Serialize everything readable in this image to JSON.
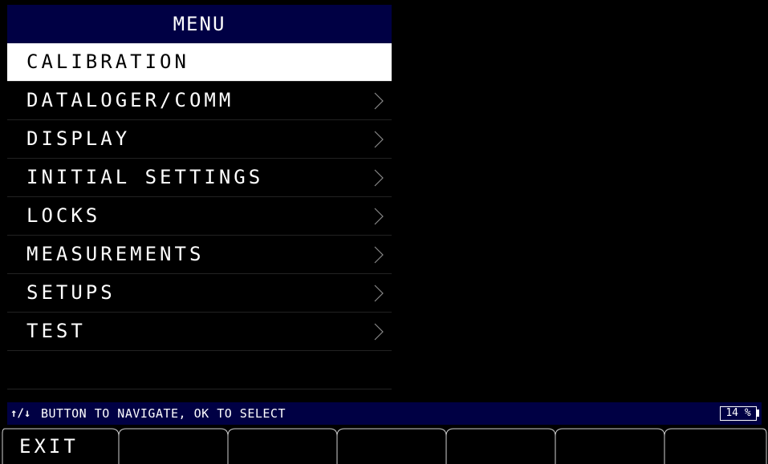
{
  "menu": {
    "title": "MENU",
    "items": [
      {
        "label": "CALIBRATION",
        "selected": true,
        "has_submenu": false
      },
      {
        "label": "DATALOGER/COMM",
        "selected": false,
        "has_submenu": true
      },
      {
        "label": "DISPLAY",
        "selected": false,
        "has_submenu": true
      },
      {
        "label": "INITIAL SETTINGS",
        "selected": false,
        "has_submenu": true
      },
      {
        "label": "LOCKS",
        "selected": false,
        "has_submenu": true
      },
      {
        "label": "MEASUREMENTS",
        "selected": false,
        "has_submenu": true
      },
      {
        "label": "SETUPS",
        "selected": false,
        "has_submenu": true
      },
      {
        "label": "TEST",
        "selected": false,
        "has_submenu": true
      }
    ]
  },
  "status": {
    "arrows": "↑/↓",
    "hint": "BUTTON TO NAVIGATE, OK TO SELECT",
    "battery_percent": "14 %"
  },
  "softkeys": [
    {
      "label": "EXIT"
    },
    {
      "label": ""
    },
    {
      "label": ""
    },
    {
      "label": ""
    },
    {
      "label": ""
    },
    {
      "label": ""
    },
    {
      "label": ""
    }
  ],
  "colors": {
    "background": "#000000",
    "header": "#000044",
    "selected_bg": "#ffffff",
    "text": "#ffffff"
  }
}
